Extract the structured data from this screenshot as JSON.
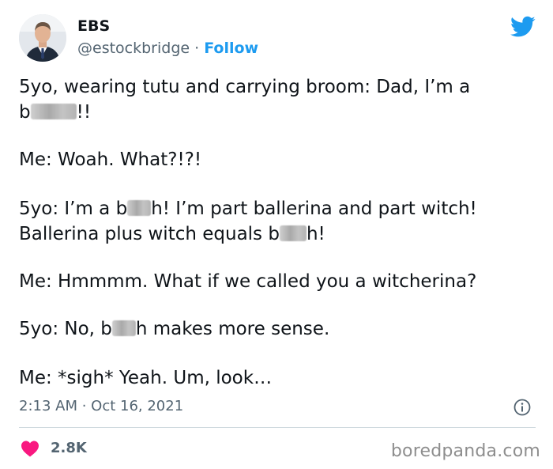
{
  "author": {
    "name": "EBS",
    "handle": "@estockbridge",
    "separator": "·",
    "follow_label": "Follow"
  },
  "platform_icon": "twitter-bird-icon",
  "tweet": {
    "p1": {
      "a": "5yo, wearing tutu and carrying broom: Dad, I’m a",
      "b_pre": "b",
      "b_post": "!!"
    },
    "p2": "Me: Woah. What?!?!",
    "p3": {
      "a": "5yo: I’m a b",
      "b": "h! I’m part ballerina and part witch!",
      "c": "Ballerina plus witch equals b",
      "d": "h!"
    },
    "p4": "Me: Hmmmm. What if we called you a witcherina?",
    "p5": {
      "a": "5yo: No, b",
      "b": "h makes more sense."
    },
    "p6": "Me: *sigh* Yeah. Um, look…"
  },
  "timestamp": "2:13 AM · Oct 16, 2021",
  "likes": "2.8K",
  "watermark": "boredpanda.com",
  "colors": {
    "accent": "#1d9bf0",
    "heart": "#f91880",
    "muted": "#536471"
  }
}
